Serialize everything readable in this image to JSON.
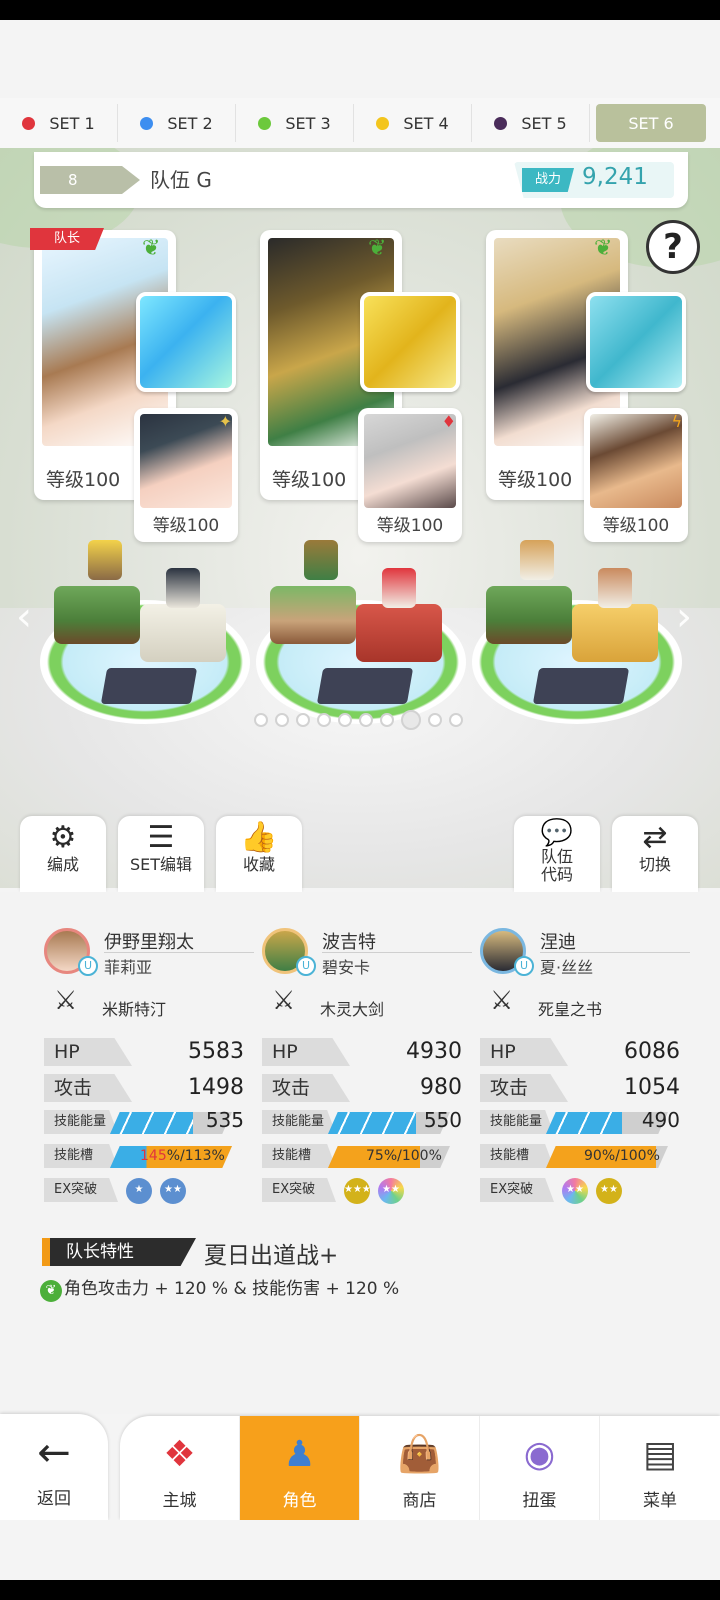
{
  "set_tabs": [
    {
      "label": "SET 1",
      "color": "#e0353d"
    },
    {
      "label": "SET 2",
      "color": "#3d8ef0"
    },
    {
      "label": "SET 3",
      "color": "#6cc93c"
    },
    {
      "label": "SET 4",
      "color": "#f3c51d"
    },
    {
      "label": "SET 5",
      "color": "#4a2c5a"
    },
    {
      "label": "SET 6",
      "active": true
    }
  ],
  "team": {
    "number": "8",
    "name": "队伍 G",
    "power_label": "战力",
    "power_value": "9,241"
  },
  "help_symbol": "?",
  "leader_badge": "队长",
  "cards": [
    {
      "level": "等级100",
      "sub_level": "等级100",
      "element": "leaf-icon"
    },
    {
      "level": "等级100",
      "sub_level": "等级100",
      "element": "leaf-icon"
    },
    {
      "level": "等级100",
      "sub_level": "等级100",
      "element": "leaf-icon"
    }
  ],
  "pager": {
    "total": 10,
    "current": 8
  },
  "actions": {
    "formation": "编成",
    "set_edit": "SET编辑",
    "favorite": "收藏",
    "team_code": "队伍\n代码",
    "switch": "切换"
  },
  "characters": [
    {
      "name": "伊野里翔太",
      "partner": "菲莉亚",
      "weapon": "米斯特汀",
      "hp_label": "HP",
      "hp": "5583",
      "atk_label": "攻击",
      "atk": "1498",
      "skill_energy_label": "技能能量",
      "skill_energy": "535",
      "skill_energy_fill": 0.68,
      "skill_slot_label": "技能槽",
      "skill_slot_cur": "145",
      "skill_slot_max": "113",
      "skill_slot_fill": 1.0,
      "ex_label": "EX突破"
    },
    {
      "name": "波吉特",
      "partner": "碧安卡",
      "weapon": "木灵大剑",
      "hp_label": "HP",
      "hp": "4930",
      "atk_label": "攻击",
      "atk": "980",
      "skill_energy_label": "技能能量",
      "skill_energy": "550",
      "skill_energy_fill": 0.72,
      "skill_slot_label": "技能槽",
      "skill_slot_cur": "75",
      "skill_slot_max": "100",
      "skill_slot_fill": 0.75,
      "ex_label": "EX突破"
    },
    {
      "name": "涅迪",
      "partner": "夏·丝丝",
      "weapon": "死皇之书",
      "hp_label": "HP",
      "hp": "6086",
      "atk_label": "攻击",
      "atk": "1054",
      "skill_energy_label": "技能能量",
      "skill_energy": "490",
      "skill_energy_fill": 0.62,
      "skill_slot_label": "技能槽",
      "skill_slot_cur": "90",
      "skill_slot_max": "100",
      "skill_slot_fill": 0.9,
      "ex_label": "EX突破"
    }
  ],
  "leader_skill": {
    "title": "队长特性",
    "name": "夏日出道战+",
    "desc": "角色攻击力 + 120 % & 技能伤害 + 120 %"
  },
  "nav": {
    "back": "返回",
    "items": [
      {
        "label": "主城"
      },
      {
        "label": "角色",
        "active": true
      },
      {
        "label": "商店"
      },
      {
        "label": "扭蛋"
      },
      {
        "label": "菜单"
      }
    ]
  }
}
